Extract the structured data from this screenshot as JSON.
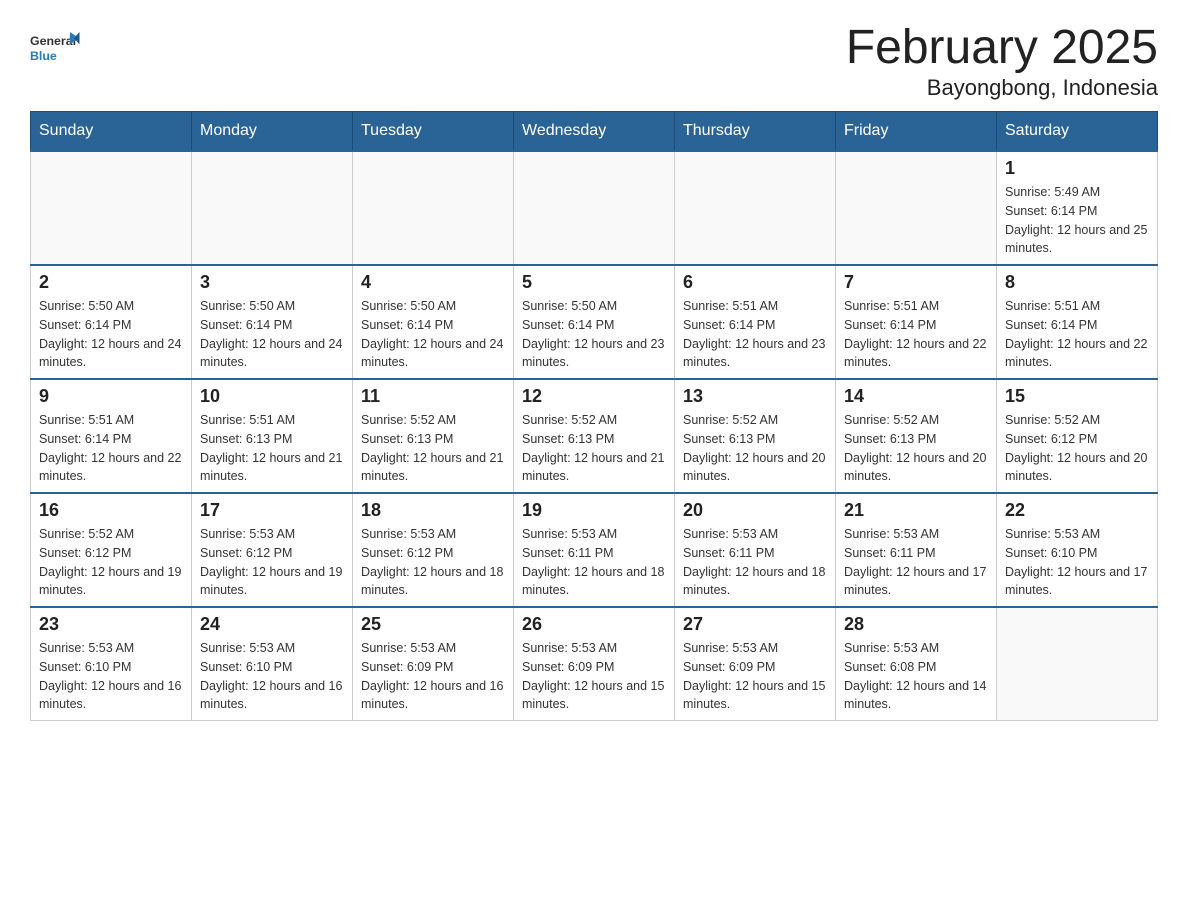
{
  "header": {
    "logo_general": "General",
    "logo_blue": "Blue",
    "title": "February 2025",
    "subtitle": "Bayongbong, Indonesia"
  },
  "weekdays": [
    "Sunday",
    "Monday",
    "Tuesday",
    "Wednesday",
    "Thursday",
    "Friday",
    "Saturday"
  ],
  "weeks": [
    [
      {
        "day": "",
        "info": ""
      },
      {
        "day": "",
        "info": ""
      },
      {
        "day": "",
        "info": ""
      },
      {
        "day": "",
        "info": ""
      },
      {
        "day": "",
        "info": ""
      },
      {
        "day": "",
        "info": ""
      },
      {
        "day": "1",
        "info": "Sunrise: 5:49 AM\nSunset: 6:14 PM\nDaylight: 12 hours and 25 minutes."
      }
    ],
    [
      {
        "day": "2",
        "info": "Sunrise: 5:50 AM\nSunset: 6:14 PM\nDaylight: 12 hours and 24 minutes."
      },
      {
        "day": "3",
        "info": "Sunrise: 5:50 AM\nSunset: 6:14 PM\nDaylight: 12 hours and 24 minutes."
      },
      {
        "day": "4",
        "info": "Sunrise: 5:50 AM\nSunset: 6:14 PM\nDaylight: 12 hours and 24 minutes."
      },
      {
        "day": "5",
        "info": "Sunrise: 5:50 AM\nSunset: 6:14 PM\nDaylight: 12 hours and 23 minutes."
      },
      {
        "day": "6",
        "info": "Sunrise: 5:51 AM\nSunset: 6:14 PM\nDaylight: 12 hours and 23 minutes."
      },
      {
        "day": "7",
        "info": "Sunrise: 5:51 AM\nSunset: 6:14 PM\nDaylight: 12 hours and 22 minutes."
      },
      {
        "day": "8",
        "info": "Sunrise: 5:51 AM\nSunset: 6:14 PM\nDaylight: 12 hours and 22 minutes."
      }
    ],
    [
      {
        "day": "9",
        "info": "Sunrise: 5:51 AM\nSunset: 6:14 PM\nDaylight: 12 hours and 22 minutes."
      },
      {
        "day": "10",
        "info": "Sunrise: 5:51 AM\nSunset: 6:13 PM\nDaylight: 12 hours and 21 minutes."
      },
      {
        "day": "11",
        "info": "Sunrise: 5:52 AM\nSunset: 6:13 PM\nDaylight: 12 hours and 21 minutes."
      },
      {
        "day": "12",
        "info": "Sunrise: 5:52 AM\nSunset: 6:13 PM\nDaylight: 12 hours and 21 minutes."
      },
      {
        "day": "13",
        "info": "Sunrise: 5:52 AM\nSunset: 6:13 PM\nDaylight: 12 hours and 20 minutes."
      },
      {
        "day": "14",
        "info": "Sunrise: 5:52 AM\nSunset: 6:13 PM\nDaylight: 12 hours and 20 minutes."
      },
      {
        "day": "15",
        "info": "Sunrise: 5:52 AM\nSunset: 6:12 PM\nDaylight: 12 hours and 20 minutes."
      }
    ],
    [
      {
        "day": "16",
        "info": "Sunrise: 5:52 AM\nSunset: 6:12 PM\nDaylight: 12 hours and 19 minutes."
      },
      {
        "day": "17",
        "info": "Sunrise: 5:53 AM\nSunset: 6:12 PM\nDaylight: 12 hours and 19 minutes."
      },
      {
        "day": "18",
        "info": "Sunrise: 5:53 AM\nSunset: 6:12 PM\nDaylight: 12 hours and 18 minutes."
      },
      {
        "day": "19",
        "info": "Sunrise: 5:53 AM\nSunset: 6:11 PM\nDaylight: 12 hours and 18 minutes."
      },
      {
        "day": "20",
        "info": "Sunrise: 5:53 AM\nSunset: 6:11 PM\nDaylight: 12 hours and 18 minutes."
      },
      {
        "day": "21",
        "info": "Sunrise: 5:53 AM\nSunset: 6:11 PM\nDaylight: 12 hours and 17 minutes."
      },
      {
        "day": "22",
        "info": "Sunrise: 5:53 AM\nSunset: 6:10 PM\nDaylight: 12 hours and 17 minutes."
      }
    ],
    [
      {
        "day": "23",
        "info": "Sunrise: 5:53 AM\nSunset: 6:10 PM\nDaylight: 12 hours and 16 minutes."
      },
      {
        "day": "24",
        "info": "Sunrise: 5:53 AM\nSunset: 6:10 PM\nDaylight: 12 hours and 16 minutes."
      },
      {
        "day": "25",
        "info": "Sunrise: 5:53 AM\nSunset: 6:09 PM\nDaylight: 12 hours and 16 minutes."
      },
      {
        "day": "26",
        "info": "Sunrise: 5:53 AM\nSunset: 6:09 PM\nDaylight: 12 hours and 15 minutes."
      },
      {
        "day": "27",
        "info": "Sunrise: 5:53 AM\nSunset: 6:09 PM\nDaylight: 12 hours and 15 minutes."
      },
      {
        "day": "28",
        "info": "Sunrise: 5:53 AM\nSunset: 6:08 PM\nDaylight: 12 hours and 14 minutes."
      },
      {
        "day": "",
        "info": ""
      }
    ]
  ]
}
